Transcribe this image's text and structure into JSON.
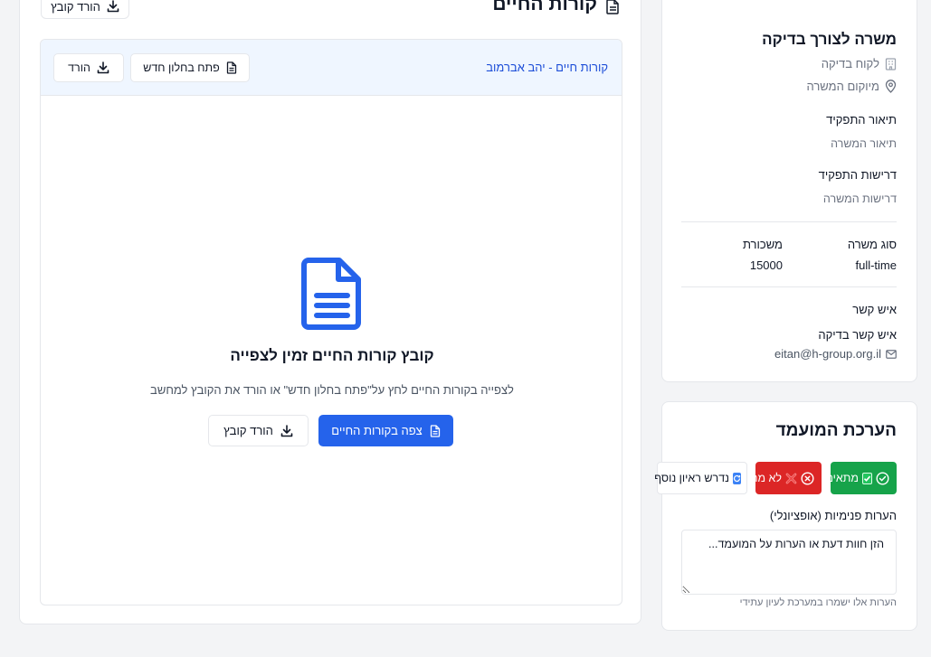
{
  "cv_panel": {
    "title": "קורות החיים",
    "top_download_label": "הורד קובץ",
    "viewer": {
      "file_name": "קורות חיים - יהב אברמוב",
      "open_new_window_label": "פתח בחלון חדש",
      "download_label": "הורד",
      "ready_title": "קובץ קורות החיים זמין לצפייה",
      "instructions": "לצפייה בקורות החיים לחץ על\"פתח בחלון חדש\" או הורד את הקובץ למחשב",
      "view_button_label": "צפה בקורות החיים",
      "download_button_label": "הורד קובץ"
    }
  },
  "job_panel": {
    "title": "משרה לצורך בדיקה",
    "client": "לקוח בדיקה",
    "location": "מיוקום המשרה",
    "description_label": "תיאור התפקיד",
    "description_value": "תיאור המשרה",
    "requirements_label": "דרישות התפקיד",
    "requirements_value": "דרישות המשרה",
    "job_type_label": "סוג משרה",
    "job_type_value": "full-time",
    "salary_label": "משכורת",
    "salary_value": "15000",
    "contact_label": "איש קשר",
    "contact_name": "איש קשר בדיקה",
    "contact_email": "eitan@h-group.org.il"
  },
  "eval_panel": {
    "title": "הערכת המועמד",
    "suitable_label": "מתאים",
    "not_suitable_label": "לא מתאים",
    "more_interview_label": "נדרש ראיון נוסף",
    "notes_label": "הערות פנימיות (אופציונלי)",
    "notes_placeholder": "הזן חוות דעת או הערות על המועמד...",
    "notes_hint": "הערות אלו ישמרו במערכת לעיון עתידי"
  },
  "colors": {
    "primary": "#2563eb",
    "success": "#16a34a",
    "danger": "#dc2626",
    "viewer_header_bg": "#eff6ff",
    "page_bg": "#f3f4f6"
  },
  "icons": [
    "document-icon",
    "download-icon",
    "building-icon",
    "map-pin-icon",
    "mail-icon",
    "check-circle-icon",
    "x-circle-icon",
    "refresh-icon"
  ]
}
